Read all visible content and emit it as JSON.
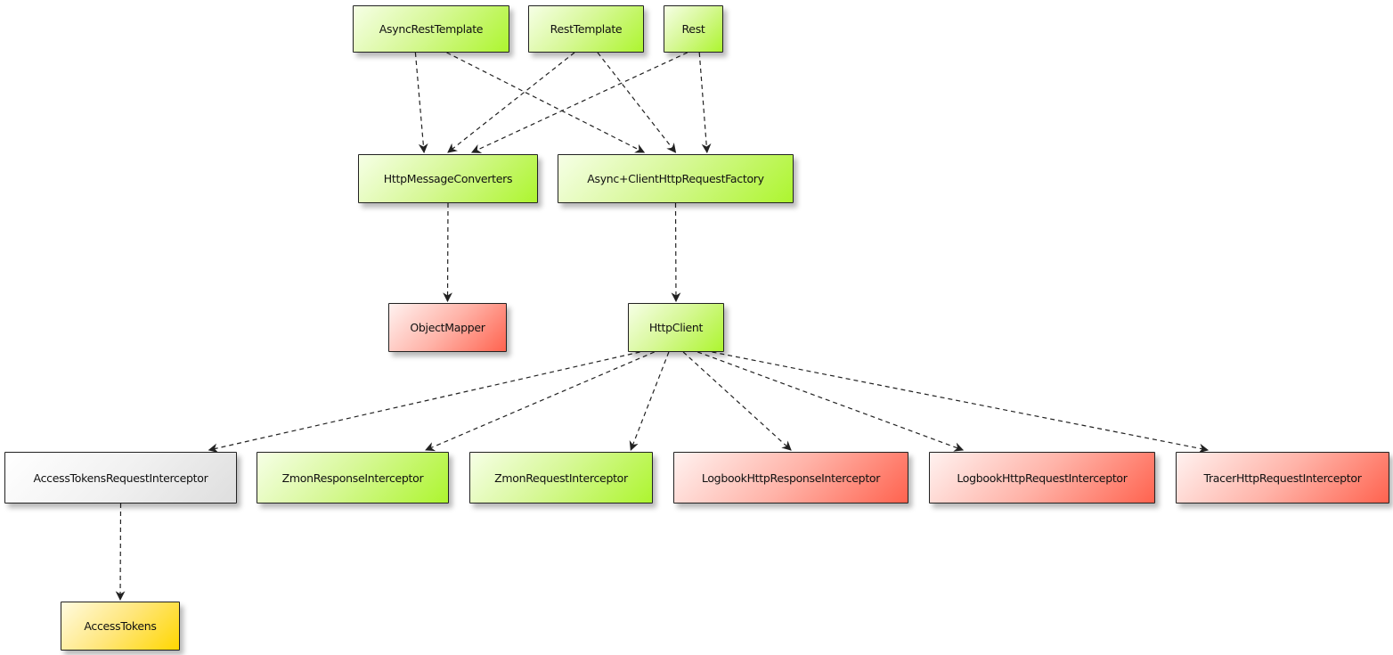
{
  "diagram": {
    "type": "dependency-graph",
    "style": "hand-drawn",
    "edge_style": "dashed-arrow",
    "colors": {
      "green": "#adf52f",
      "red": "#ff634f",
      "gray": "#dedede",
      "yellow": "#ffd700",
      "edge": "#222222"
    },
    "nodes": [
      {
        "id": "asyncresttemplate",
        "label": "AsyncRestTemplate",
        "color": "green"
      },
      {
        "id": "resttemplate",
        "label": "RestTemplate",
        "color": "green"
      },
      {
        "id": "rest",
        "label": "Rest",
        "color": "green"
      },
      {
        "id": "httpmessageconverters",
        "label": "HttpMessageConverters",
        "color": "green"
      },
      {
        "id": "asyncclienthttprequestfactory",
        "label": "Async+ClientHttpRequestFactory",
        "color": "green"
      },
      {
        "id": "objectmapper",
        "label": "ObjectMapper",
        "color": "red"
      },
      {
        "id": "httpclient",
        "label": "HttpClient",
        "color": "green"
      },
      {
        "id": "accesstokensrequestinterceptor",
        "label": "AccessTokensRequestInterceptor",
        "color": "gray"
      },
      {
        "id": "zmonresponseinterceptor",
        "label": "ZmonResponseInterceptor",
        "color": "green"
      },
      {
        "id": "zmonrequestinterceptor",
        "label": "ZmonRequestInterceptor",
        "color": "green"
      },
      {
        "id": "logbookhttpresponseinterceptor",
        "label": "LogbookHttpResponseInterceptor",
        "color": "red"
      },
      {
        "id": "logbookhttprequestinterceptor",
        "label": "LogbookHttpRequestInterceptor",
        "color": "red"
      },
      {
        "id": "tracerhttprequestinterceptor",
        "label": "TracerHttpRequestInterceptor",
        "color": "red"
      },
      {
        "id": "accesstokens",
        "label": "AccessTokens",
        "color": "yellow"
      }
    ],
    "edges": [
      {
        "from": "asyncresttemplate",
        "to": "httpmessageconverters"
      },
      {
        "from": "asyncresttemplate",
        "to": "asyncclienthttprequestfactory"
      },
      {
        "from": "resttemplate",
        "to": "httpmessageconverters"
      },
      {
        "from": "resttemplate",
        "to": "asyncclienthttprequestfactory"
      },
      {
        "from": "rest",
        "to": "httpmessageconverters"
      },
      {
        "from": "rest",
        "to": "asyncclienthttprequestfactory"
      },
      {
        "from": "httpmessageconverters",
        "to": "objectmapper"
      },
      {
        "from": "asyncclienthttprequestfactory",
        "to": "httpclient"
      },
      {
        "from": "httpclient",
        "to": "accesstokensrequestinterceptor"
      },
      {
        "from": "httpclient",
        "to": "zmonresponseinterceptor"
      },
      {
        "from": "httpclient",
        "to": "zmonrequestinterceptor"
      },
      {
        "from": "httpclient",
        "to": "logbookhttpresponseinterceptor"
      },
      {
        "from": "httpclient",
        "to": "logbookhttprequestinterceptor"
      },
      {
        "from": "httpclient",
        "to": "tracerhttprequestinterceptor"
      },
      {
        "from": "accesstokensrequestinterceptor",
        "to": "accesstokens"
      }
    ]
  }
}
